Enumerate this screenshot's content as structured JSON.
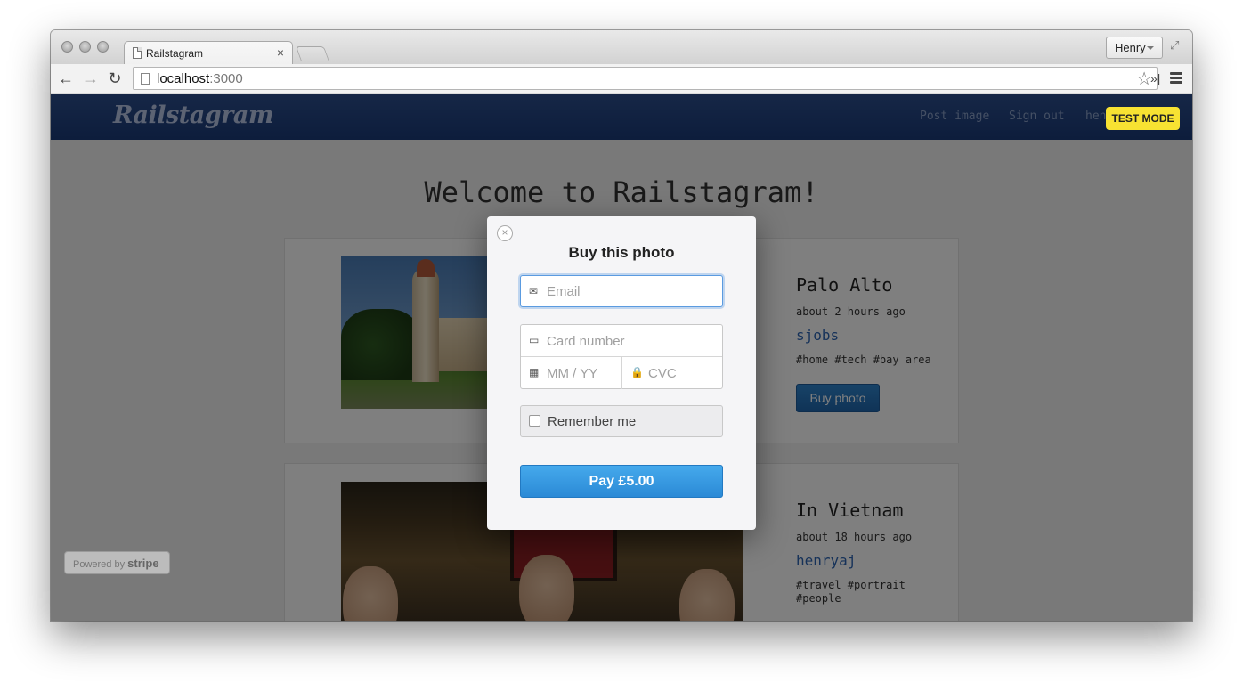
{
  "browser": {
    "tab_title": "Railstagram",
    "tab_close": "×",
    "profile_name": "Henry",
    "url_host": "localhost",
    "url_port": ":3000",
    "back_glyph": "←",
    "forward_glyph": "→",
    "reload_glyph": "↻",
    "star_glyph": "☆",
    "extensions_glyph": "»|",
    "fullscreen_glyph": "⤢"
  },
  "app": {
    "logo": "Railstagram",
    "nav": [
      "Post image",
      "Sign out",
      "hen"
    ],
    "welcome": "Welcome to Railstagram!",
    "test_mode": "TEST MODE",
    "powered_by": "Powered by",
    "powered_brand": "stripe"
  },
  "posts": [
    {
      "title": "Palo Alto",
      "time": "about 2 hours ago",
      "user": "sjobs",
      "tags": "#home #tech #bay area",
      "buy_label": "Buy photo"
    },
    {
      "title": "In Vietnam",
      "time": "about 18 hours ago",
      "user": "henryaj",
      "tags": "#travel #portrait #people"
    }
  ],
  "checkout": {
    "close_glyph": "×",
    "title": "Buy this photo",
    "email_placeholder": "Email",
    "card_placeholder": "Card number",
    "expiry_placeholder": "MM / YY",
    "cvc_placeholder": "CVC",
    "remember_label": "Remember me",
    "pay_label": "Pay £5.00"
  },
  "icons": {
    "email": "✉",
    "card": "▭",
    "calendar": "▦",
    "lock": "🔒"
  },
  "colors": {
    "nav_bg": "#1a3a78",
    "pay_button": "#2b8ad6",
    "test_badge": "#f7e232",
    "link": "#2c64b3"
  }
}
